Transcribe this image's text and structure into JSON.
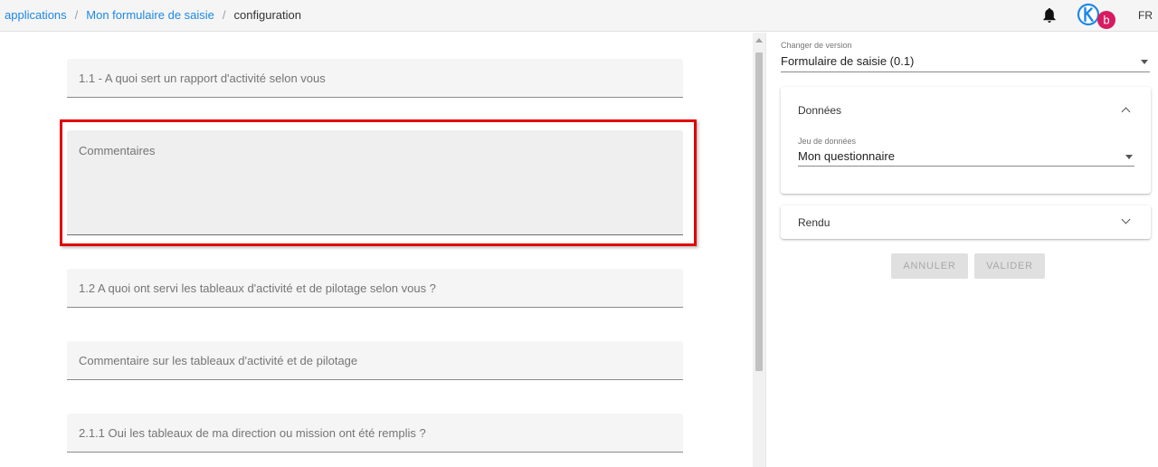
{
  "breadcrumb": {
    "items": [
      "applications",
      "Mon formulaire de saisie"
    ],
    "separator": "/",
    "current": "configuration"
  },
  "header": {
    "bell_icon": "bell-icon",
    "logo_icon": "app-logo-k-icon",
    "avatar_letter": "b",
    "language": "FR"
  },
  "form": {
    "fields": [
      "1.1 - A quoi sert un rapport d'activité selon vous",
      "Commentaires",
      "1.2 A quoi ont servi les tableaux d'activité et de pilotage selon vous ?",
      "Commentaire sur les tableaux d'activité et de pilotage",
      "2.1.1 Oui les tableaux de ma direction ou mission ont été remplis ?"
    ]
  },
  "panel": {
    "version_label": "Changer de version",
    "version_value": "Formulaire de saisie (0.1)",
    "donnees": {
      "title": "Données",
      "jeu_label": "Jeu de données",
      "jeu_value": "Mon questionnaire"
    },
    "rendu": {
      "title": "Rendu"
    },
    "buttons": {
      "cancel": "ANNULER",
      "validate": "VALIDER"
    }
  },
  "colors": {
    "link": "#1e88e5",
    "highlight": "#e00000",
    "avatar": "#d81b60"
  }
}
